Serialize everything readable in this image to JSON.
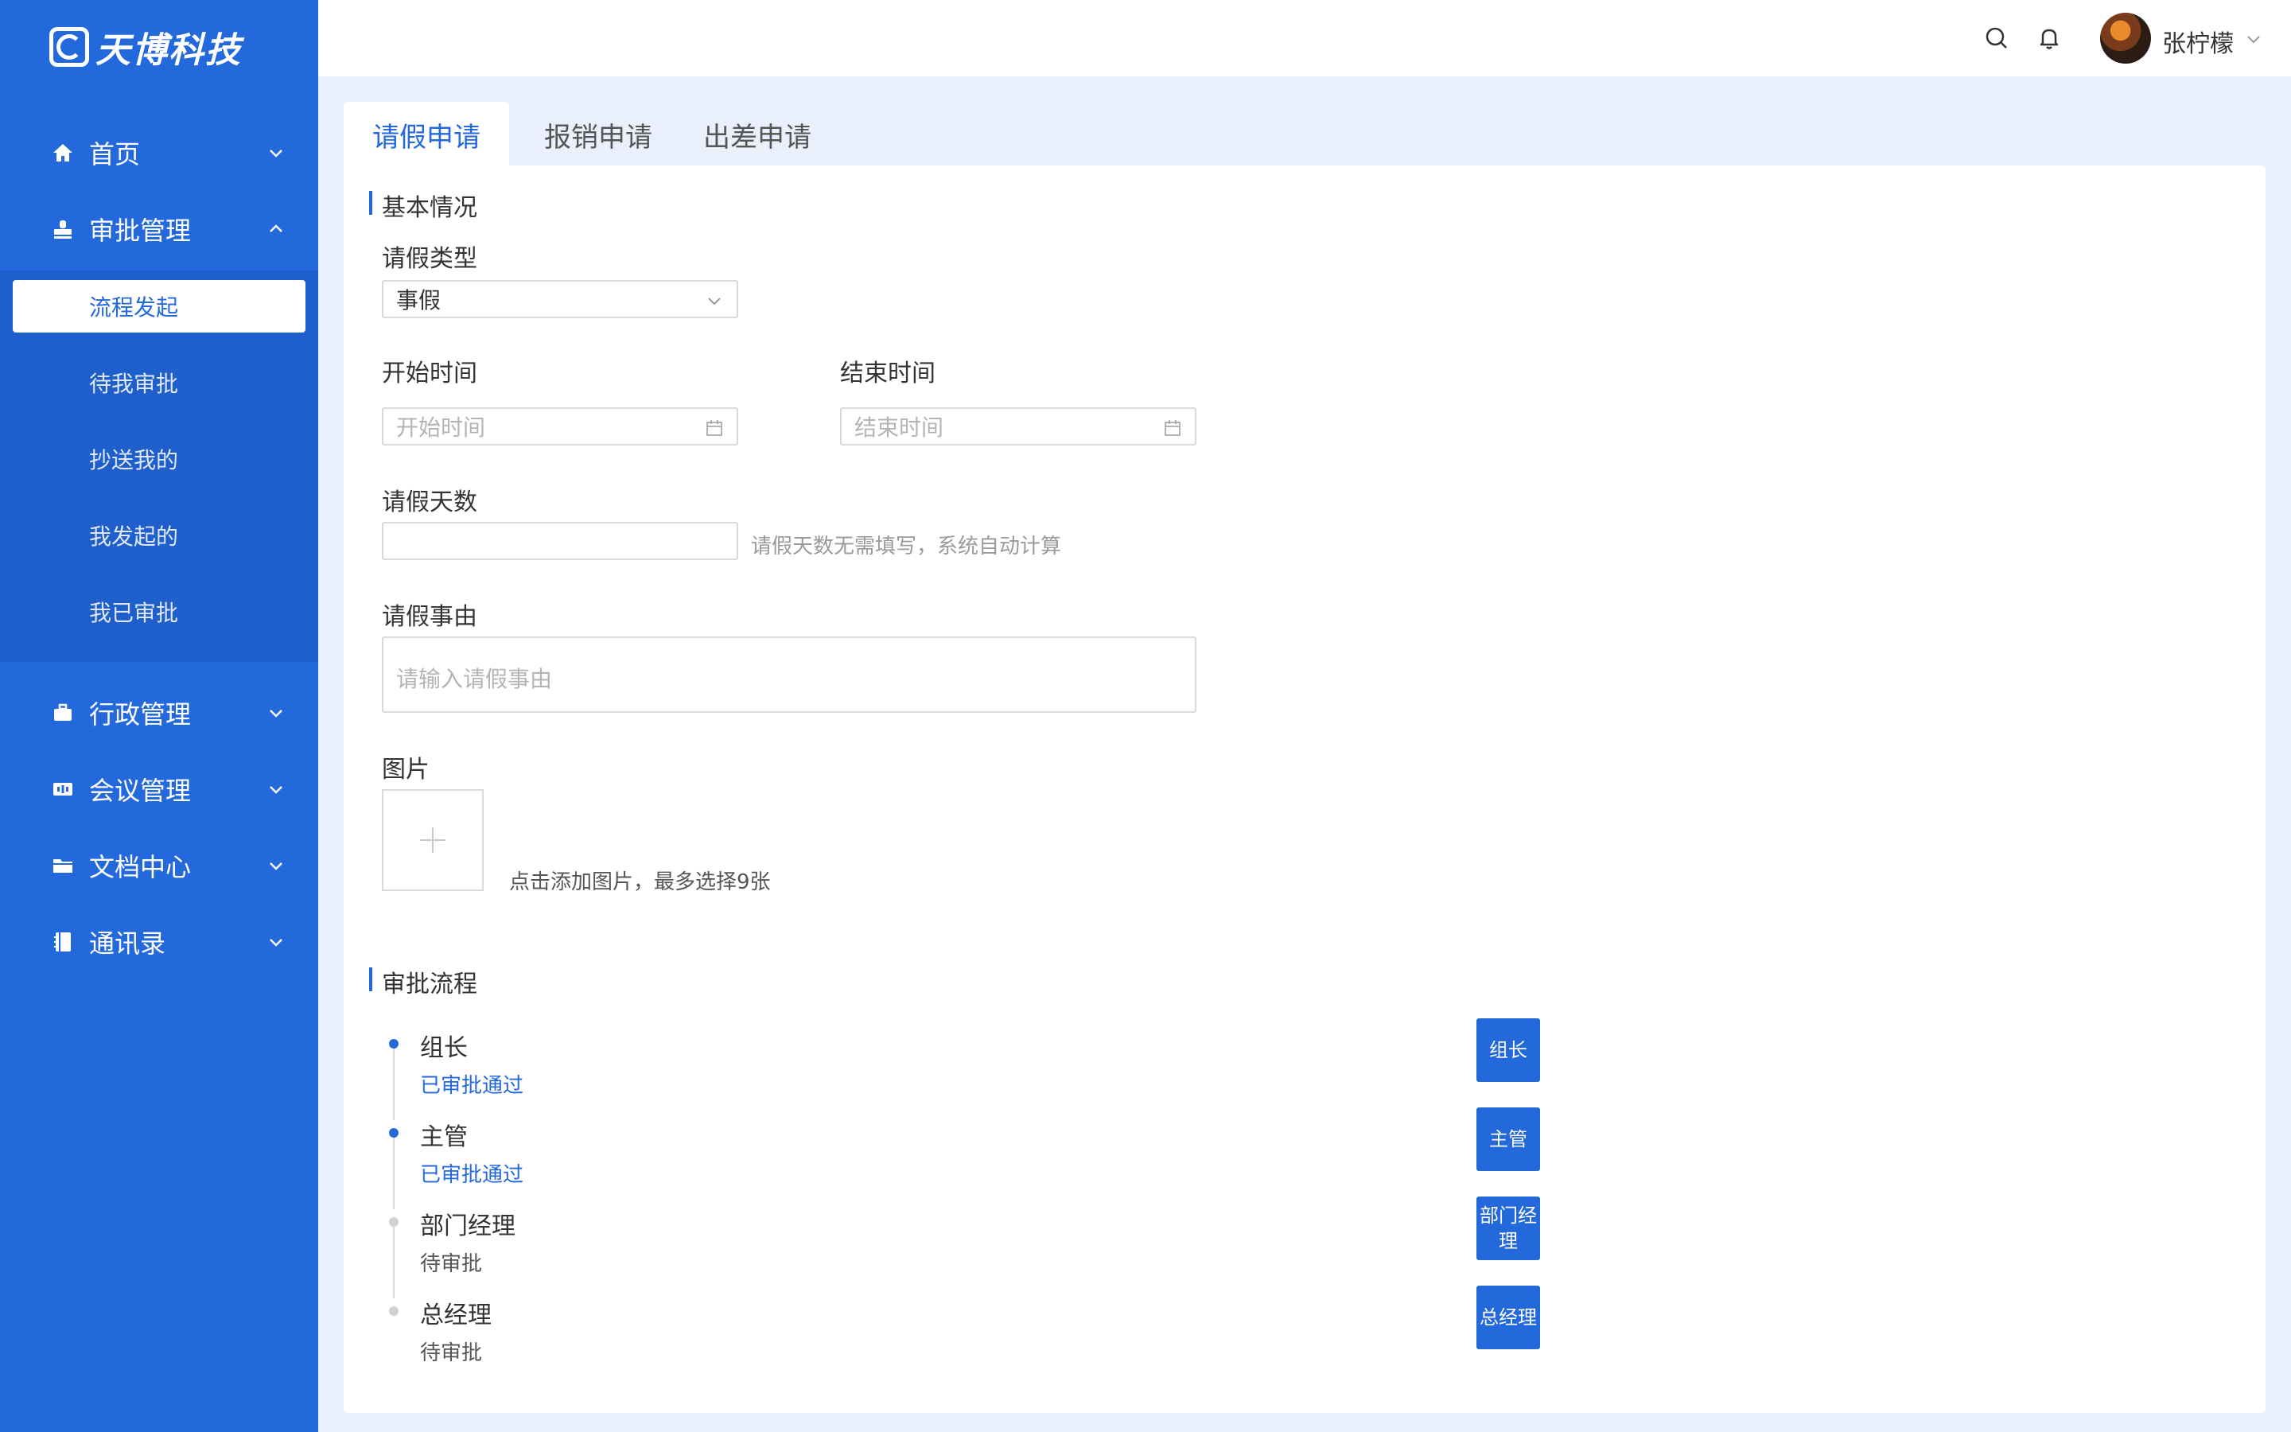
{
  "app": {
    "logo_text": "天博科技"
  },
  "sidebar": {
    "items": [
      {
        "label": "首页",
        "icon": "home-icon"
      },
      {
        "label": "审批管理",
        "icon": "stamp-icon"
      },
      {
        "label": "行政管理",
        "icon": "briefcase-icon"
      },
      {
        "label": "会议管理",
        "icon": "meeting-icon"
      },
      {
        "label": "文档中心",
        "icon": "folder-icon"
      },
      {
        "label": "通讯录",
        "icon": "address-book-icon"
      }
    ],
    "submenu": [
      {
        "label": "流程发起",
        "active": true
      },
      {
        "label": "待我审批"
      },
      {
        "label": "抄送我的"
      },
      {
        "label": "我发起的"
      },
      {
        "label": "我已审批"
      }
    ]
  },
  "header": {
    "username": "张柠檬"
  },
  "tabs": [
    {
      "label": "请假申请",
      "active": true
    },
    {
      "label": "报销申请"
    },
    {
      "label": "出差申请"
    }
  ],
  "form": {
    "section_basic": "基本情况",
    "leave_type": {
      "label": "请假类型",
      "value": "事假"
    },
    "start_time": {
      "label": "开始时间",
      "placeholder": "开始时间"
    },
    "end_time": {
      "label": "结束时间",
      "placeholder": "结束时间"
    },
    "leave_days": {
      "label": "请假天数",
      "value": "",
      "hint": "请假天数无需填写，系统自动计算"
    },
    "reason": {
      "label": "请假事由",
      "placeholder": "请输入请假事由"
    },
    "image": {
      "label": "图片",
      "hint": "点击添加图片，最多选择9张"
    }
  },
  "approval": {
    "section_title": "审批流程",
    "steps": [
      {
        "name": "组长",
        "status": "已审批通过",
        "state": "done",
        "button": "组长"
      },
      {
        "name": "主管",
        "status": "已审批通过",
        "state": "done",
        "button": "主管"
      },
      {
        "name": "部门经理",
        "status": "待审批",
        "state": "pending",
        "button": "部门经理"
      },
      {
        "name": "总经理",
        "status": "待审批",
        "state": "pending",
        "button": "总经理"
      }
    ]
  },
  "colors": {
    "primary": "#2369dc",
    "sidebar_sub": "#1f5fcb",
    "page_bg": "#e9f0fb"
  }
}
